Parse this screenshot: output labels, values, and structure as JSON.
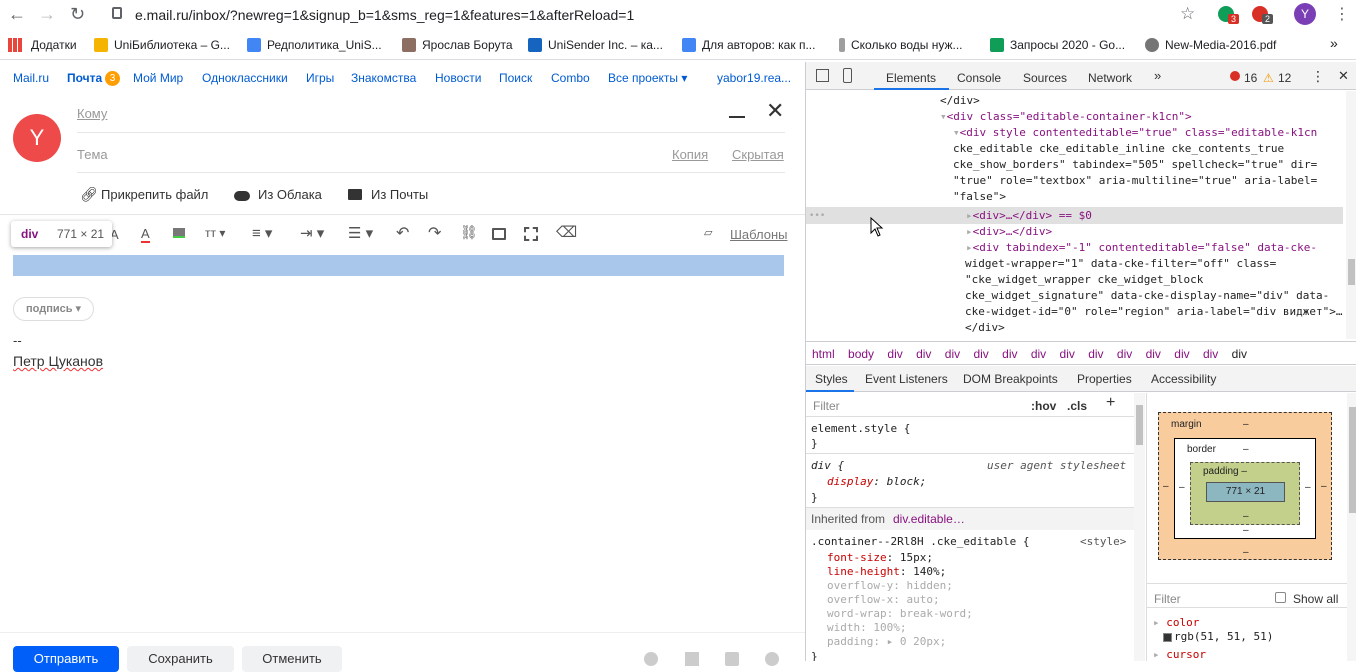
{
  "browser": {
    "url": "e.mail.ru/inbox/?newreg=1&signup_b=1&sms_reg=1&features=1&afterReload=1",
    "ext_badges": [
      "3",
      "2"
    ],
    "profile_letter": "Y",
    "bookmarks": [
      {
        "label": "Додатки",
        "color": "#4285f4"
      },
      {
        "label": "UniБиблиотека – G...",
        "color": "#f4b400"
      },
      {
        "label": "Редполитика_UniS...",
        "color": "#4285f4"
      },
      {
        "label": "Ярослав Борута",
        "color": "#8d6e63"
      },
      {
        "label": "UniSender Inc. – ка...",
        "color": "#1565c0"
      },
      {
        "label": "Для авторов: как п...",
        "color": "#4285f4"
      },
      {
        "label": "Сколько воды нуж...",
        "color": "#9e9e9e"
      },
      {
        "label": "Запросы 2020 - Go...",
        "color": "#0f9d58"
      },
      {
        "label": "New-Media-2016.pdf",
        "color": "#757575"
      }
    ]
  },
  "mailnav": {
    "items": [
      "Mail.ru",
      "Почта",
      "Мой Мир",
      "Одноклассники",
      "Игры",
      "Знакомства",
      "Новости",
      "Поиск",
      "Combo",
      "Все проекты ▾",
      "yabor19.rea..."
    ],
    "mail_badge": "3"
  },
  "compose": {
    "avatar_letter": "Y",
    "to_label": "Кому",
    "subject_label": "Тема",
    "cc_label": "Копия",
    "bcc_label": "Скрытая",
    "attach_file": "Прикрепить файл",
    "from_cloud": "Из Облака",
    "from_mail": "Из Почты",
    "templates": "Шаблоны",
    "tooltip_tag": "div",
    "tooltip_size": "771 × 21",
    "signature_chip": "подпись",
    "signature_sep": "--",
    "signature_name": "Петр Цуканов",
    "send": "Отправить",
    "save": "Сохранить",
    "cancel": "Отменить"
  },
  "devtools": {
    "tabs": [
      "Elements",
      "Console",
      "Sources",
      "Network"
    ],
    "errors": "16",
    "warnings": "12",
    "dom_lines": [
      "</div>",
      "<div class=\"editable-container-k1cn\">",
      "<div style contenteditable=\"true\" class=\"editable-k1cn",
      "cke_editable cke_editable_inline cke_contents_true",
      "cke_show_borders\" tabindex=\"505\" spellcheck=\"true\" dir=",
      "\"true\" role=\"textbox\" aria-multiline=\"true\" aria-label=",
      "\"false\">",
      "<div>…</div> == $0",
      "<div>…</div>",
      "<div tabindex=\"-1\" contenteditable=\"false\" data-cke-",
      "widget-wrapper=\"1\" data-cke-filter=\"off\" class=",
      "\"cke_widget_wrapper cke_widget_block",
      "cke_widget_signature\" data-cke-display-name=\"div\" data-",
      "cke-widget-id=\"0\" role=\"region\" aria-label=\"div виджет\">…",
      "</div>"
    ],
    "breadcrumbs": [
      "html",
      "body",
      "div",
      "div",
      "div",
      "div",
      "div",
      "div",
      "div",
      "div",
      "div",
      "div",
      "div",
      "div",
      "div"
    ],
    "subtabs": [
      "Styles",
      "Event Listeners",
      "DOM Breakpoints",
      "Properties",
      "Accessibility"
    ],
    "filter": "Filter",
    "hov": ":hov",
    "cls": ".cls",
    "element_style": "element.style {",
    "rule_close": "}",
    "ua_selector": "div {",
    "ua_label": "user agent stylesheet",
    "ua_prop": "display",
    "ua_val": "block;",
    "inherited_label": "Inherited from",
    "inherited_from": "div.editable…",
    "container_selector": ".container--2Rl8H .cke_editable {",
    "style_src": "<style>",
    "props": [
      {
        "name": "font-size",
        "value": "15px;"
      },
      {
        "name": "line-height",
        "value": "140%;"
      },
      {
        "name": "overflow-y",
        "value": "hidden;"
      },
      {
        "name": "overflow-x",
        "value": "auto;"
      },
      {
        "name": "word-wrap",
        "value": "break-word;"
      },
      {
        "name": "width",
        "value": "100%;"
      },
      {
        "name": "padding",
        "value": "▸ 0 20px;"
      }
    ],
    "box_margin": "margin",
    "box_border": "border",
    "box_padding": "padding –",
    "box_content": "771 × 21",
    "box_dash": "–",
    "computed_filter": "Filter",
    "show_all": "Show all",
    "computed_color": "color",
    "computed_color_val": "rgb(51, 51, 51)",
    "computed_cursor": "cursor"
  }
}
